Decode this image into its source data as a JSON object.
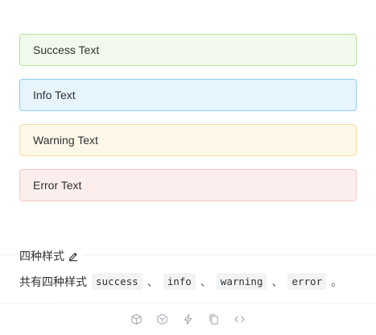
{
  "alerts": [
    {
      "type": "success",
      "text": "Success Text"
    },
    {
      "type": "info",
      "text": "Info Text"
    },
    {
      "type": "warning",
      "text": "Warning Text"
    },
    {
      "type": "error",
      "text": "Error Text"
    }
  ],
  "section": {
    "title": "四种样式",
    "edit_icon": "edit-icon"
  },
  "description": {
    "prefix": "共有四种样式",
    "codes": [
      "success",
      "info",
      "warning",
      "error"
    ],
    "separator": "、",
    "suffix": "。"
  },
  "toolbar": {
    "icons": [
      "cube-icon",
      "codesandbox-icon",
      "lightning-icon",
      "copy-icon",
      "code-icon"
    ]
  },
  "colors": {
    "success_bg": "#f0f9eb",
    "info_bg": "#e6f4fd",
    "warning_bg": "#fdf7e7",
    "error_bg": "#fdeeee",
    "icon_gray": "#a8abb2"
  }
}
